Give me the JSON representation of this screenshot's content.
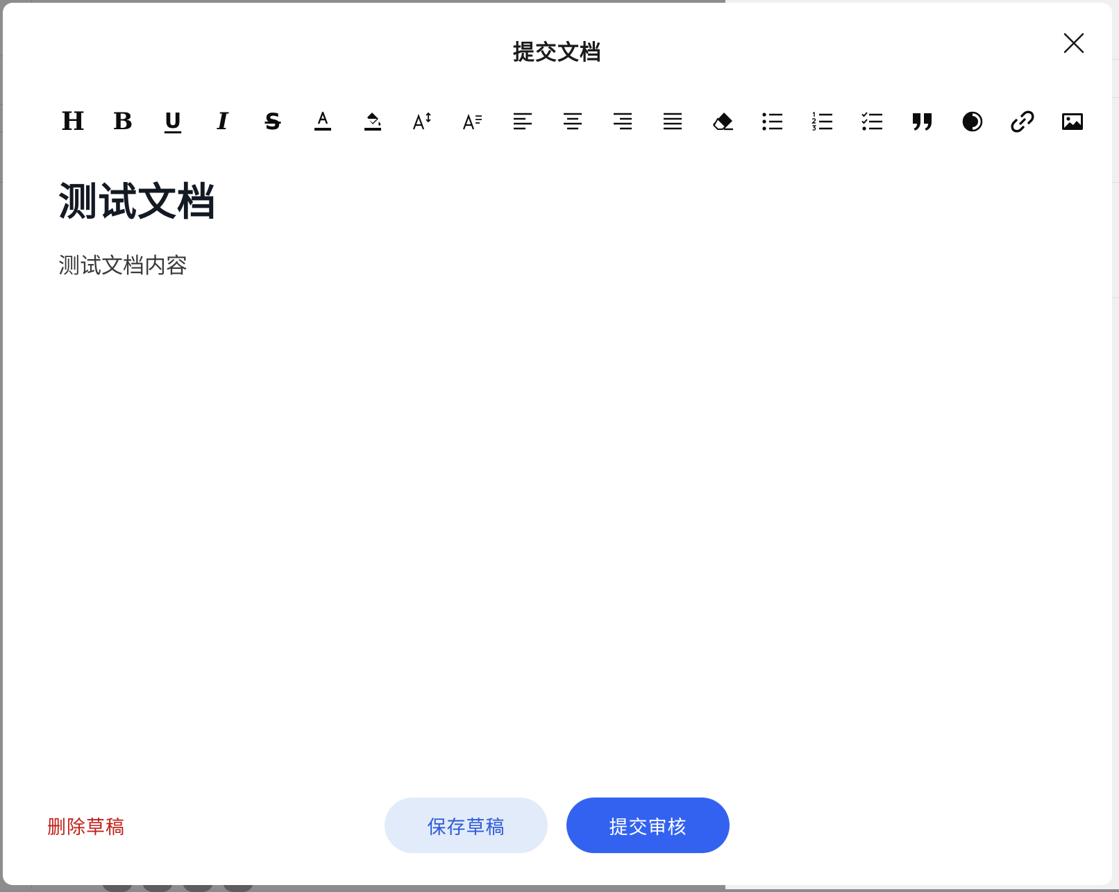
{
  "modal": {
    "title": "提交文档"
  },
  "toolbar": {
    "items": [
      {
        "icon": "heading-icon",
        "glyph": "H"
      },
      {
        "icon": "bold-icon",
        "glyph": "B"
      },
      {
        "icon": "underline-icon",
        "glyph": "U"
      },
      {
        "icon": "italic-icon",
        "glyph": "I"
      },
      {
        "icon": "strikethrough-icon",
        "glyph": "S"
      },
      {
        "icon": "font-color-icon",
        "glyph": "A"
      },
      {
        "icon": "highlight-color-icon"
      },
      {
        "icon": "font-size-icon",
        "glyph": "A"
      },
      {
        "icon": "line-height-icon",
        "glyph": "A"
      },
      {
        "icon": "align-left-icon"
      },
      {
        "icon": "align-center-icon"
      },
      {
        "icon": "align-right-icon"
      },
      {
        "icon": "align-justify-icon"
      },
      {
        "icon": "eraser-icon"
      },
      {
        "icon": "bullet-list-icon"
      },
      {
        "icon": "numbered-list-icon"
      },
      {
        "icon": "task-list-icon"
      },
      {
        "icon": "blockquote-icon"
      },
      {
        "icon": "contrast-icon"
      },
      {
        "icon": "link-icon"
      },
      {
        "icon": "image-icon"
      }
    ]
  },
  "editor": {
    "heading": "测试文档",
    "body": "测试文档内容"
  },
  "footer": {
    "delete_label": "删除草稿",
    "save_label": "保存草稿",
    "submit_label": "提交审核"
  },
  "colors": {
    "primary": "#3462f0",
    "secondary_bg": "#e2ebfa",
    "danger": "#c0201a",
    "overlay": "#8a8a8a"
  }
}
